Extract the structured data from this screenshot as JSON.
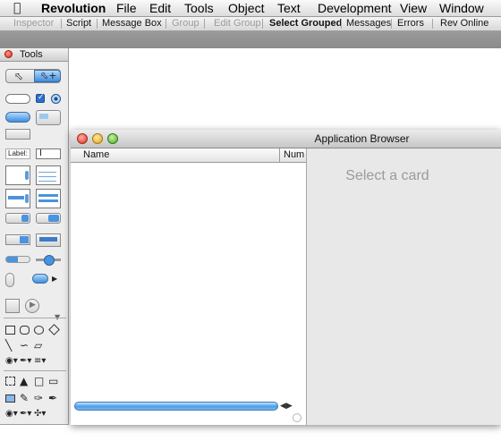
{
  "menubar": {
    "apple_icon": "apple-icon",
    "app_name": "Revolution",
    "items": [
      "File",
      "Edit",
      "Tools",
      "Object",
      "Text",
      "Development",
      "View",
      "Window"
    ]
  },
  "toolbar": {
    "items": [
      {
        "label": "Inspector",
        "enabled": false
      },
      {
        "label": "Script",
        "enabled": true
      },
      {
        "label": "Message Box",
        "enabled": true
      },
      {
        "label": "Group",
        "enabled": false
      },
      {
        "label": "Edit Group",
        "enabled": false
      },
      {
        "label": "Select Grouped",
        "enabled": true,
        "bold": true
      },
      {
        "label": "Messages",
        "enabled": true
      },
      {
        "label": "Errors",
        "enabled": true
      },
      {
        "label": "Rev Online",
        "enabled": true
      }
    ]
  },
  "tools_palette": {
    "title": "Tools",
    "label_tool": "Label:",
    "field_cursor": "I"
  },
  "app_browser": {
    "title": "Application Browser",
    "columns": [
      "Name",
      "Num"
    ],
    "placeholder": "Select a card"
  },
  "colors": {
    "accent_blue": "#3d8ee0",
    "close_red": "#d9281a",
    "minimize_yellow": "#e3a51b",
    "zoom_green": "#4aad28"
  }
}
